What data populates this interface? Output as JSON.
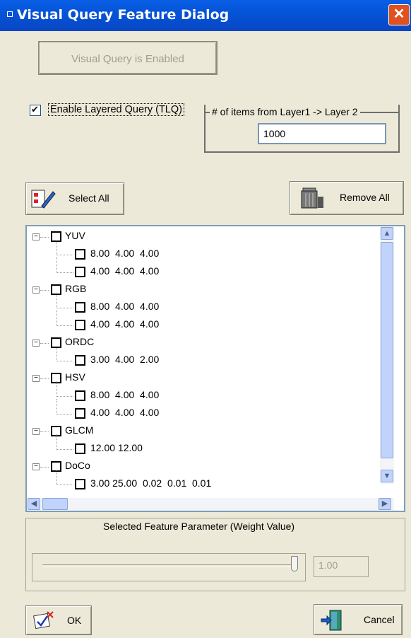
{
  "window": {
    "title": "Visual Query Feature Dialog",
    "close_glyph": "✕"
  },
  "visual_query_button": {
    "label": "Visual Query is Enabled"
  },
  "layered_query": {
    "checked": true,
    "label": "Enable Layered Query (TLQ)"
  },
  "layer_items": {
    "label": "# of items from Layer1 -> Layer 2",
    "value": "1000"
  },
  "toolbar": {
    "select_all": "Select All",
    "remove_all": "Remove All"
  },
  "tree": {
    "groups": [
      {
        "name": "YUV",
        "children": [
          "8.00  4.00  4.00",
          "4.00  4.00  4.00"
        ]
      },
      {
        "name": "RGB",
        "children": [
          "8.00  4.00  4.00",
          "4.00  4.00  4.00"
        ]
      },
      {
        "name": "ORDC",
        "children": [
          "3.00  4.00  2.00"
        ]
      },
      {
        "name": "HSV",
        "children": [
          "8.00  4.00  4.00",
          "4.00  4.00  4.00"
        ]
      },
      {
        "name": "GLCM",
        "children": [
          "12.00 12.00"
        ]
      },
      {
        "name": "DoCo",
        "children": [
          "3.00 25.00  0.02  0.01  0.01"
        ]
      }
    ]
  },
  "weight": {
    "group_label": "Selected Feature Parameter (Weight Value)",
    "value": "1.00",
    "level": 1.0
  },
  "footer": {
    "ok": "OK",
    "cancel": "Cancel"
  }
}
